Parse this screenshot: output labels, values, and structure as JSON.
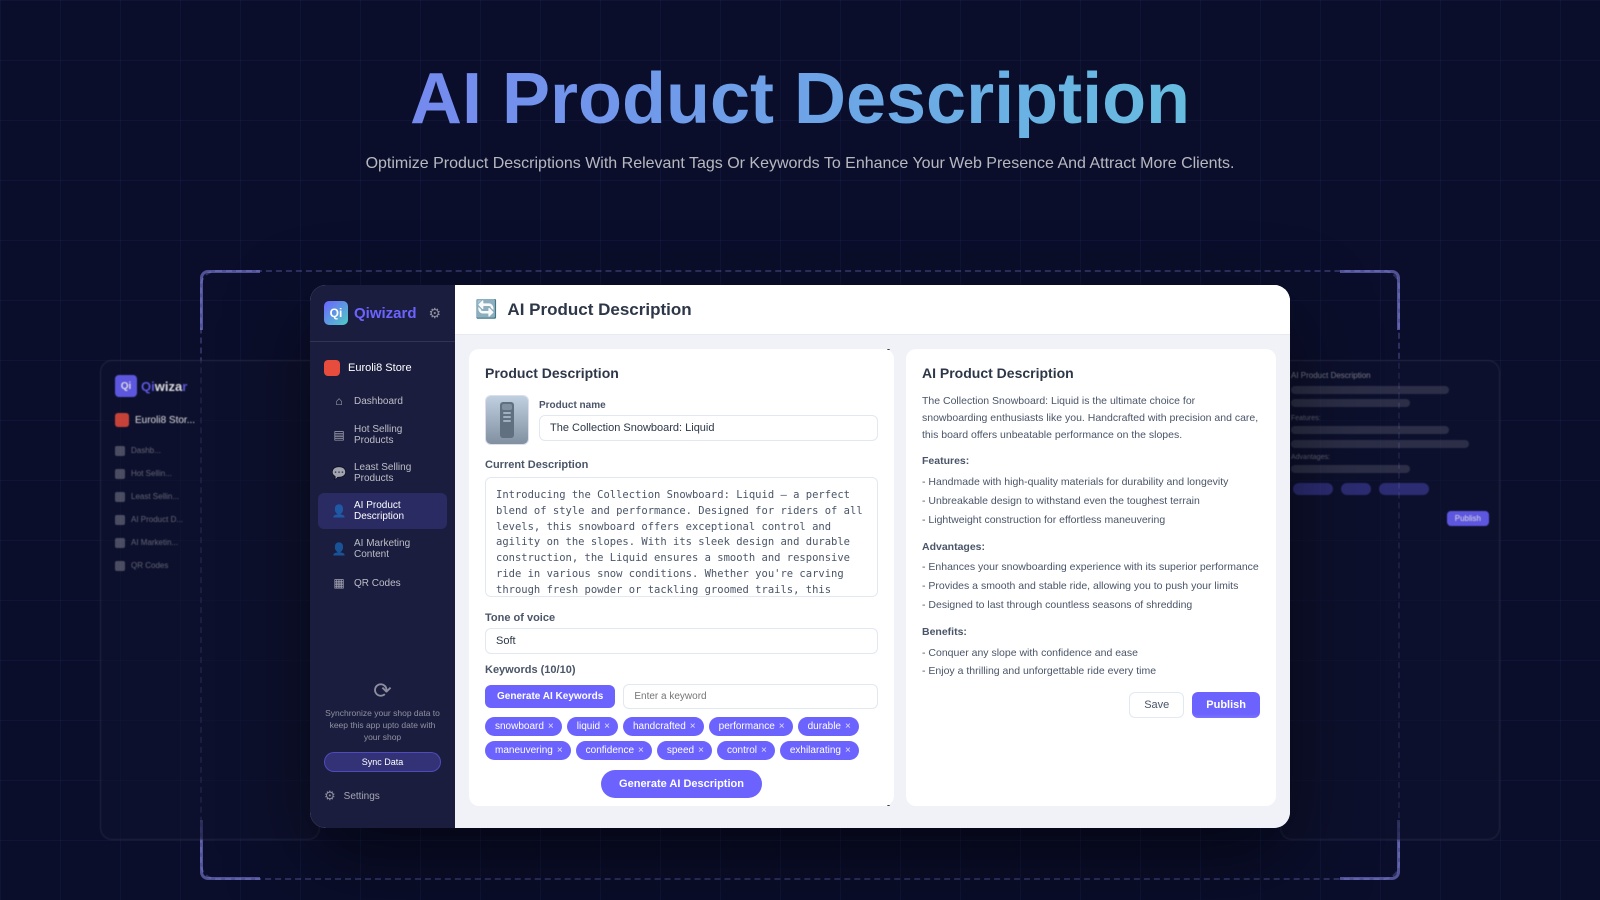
{
  "page": {
    "bg_title": "AI Product Description",
    "bg_subtitle": "Optimize Product Descriptions With Relevant Tags Or Keywords To Enhance Your Web Presence And Attract More Clients."
  },
  "sidebar": {
    "logo_letter": "Qi",
    "logo_name": "wizard",
    "store_name": "Euroli8 Store",
    "nav_items": [
      {
        "id": "dashboard",
        "label": "Dashboard",
        "icon": "⌂"
      },
      {
        "id": "hot-selling",
        "label": "Hot Selling Products",
        "icon": "▤"
      },
      {
        "id": "least-selling",
        "label": "Least Selling Products",
        "icon": "💬"
      },
      {
        "id": "ai-product",
        "label": "AI Product Description",
        "icon": "👤",
        "active": true
      },
      {
        "id": "ai-marketing",
        "label": "AI Marketing Content",
        "icon": "👤"
      },
      {
        "id": "qr-codes",
        "label": "QR Codes",
        "icon": "▦"
      }
    ],
    "sync_text": "Synchronize your shop data to keep this app upto date with your shop",
    "sync_btn": "Sync Data",
    "settings_label": "Settings"
  },
  "main": {
    "page_icon": "🔄",
    "page_title": "AI Product Description",
    "left_panel": {
      "title": "Product Description",
      "product_name_label": "Product name",
      "product_name_value": "The Collection Snowboard: Liquid",
      "current_desc_label": "Current Description",
      "current_desc_value": "Introducing the Collection Snowboard: Liquid – a perfect blend of style and performance. Designed for riders of all levels, this snowboard offers exceptional control and agility on the slopes. With its sleek design and durable construction, the Liquid ensures a smooth and responsive ride in various snow conditions. Whether you're carving through fresh powder or tackling groomed trails, this snowboard adapts effortlessly to enhance your experience. Elevate your snowboarding adventures with the Collection Snowboard: Liquid and enjoy the perfect ride every time.",
      "tone_label": "Tone of voice",
      "tone_value": "Soft",
      "keywords_label": "Keywords (10/10)",
      "generate_ai_keywords_btn": "Generate AI Keywords",
      "keyword_placeholder": "Enter a keyword",
      "tags": [
        "snowboard",
        "liquid",
        "handcrafted",
        "performance",
        "durable",
        "maneuvering",
        "confidence",
        "speed",
        "control",
        "exhilarating"
      ],
      "generate_desc_btn": "Generate AI Description"
    },
    "right_panel": {
      "title": "AI Product Description",
      "intro": "The Collection Snowboard: Liquid is the ultimate choice for snowboarding enthusiasts like you. Handcrafted with precision and care, this board offers unbeatable performance on the slopes.",
      "features_heading": "Features:",
      "features": [
        "- Handmade with high-quality materials for durability and longevity",
        "- Unbreakable design to withstand even the toughest terrain",
        "- Lightweight construction for effortless maneuvering"
      ],
      "advantages_heading": "Advantages:",
      "advantages": [
        "- Enhances your snowboarding experience with its superior performance",
        "- Provides a smooth and stable ride, allowing you to push your limits",
        "- Designed to last through countless seasons of shredding"
      ],
      "benefits_heading": "Benefits:",
      "benefits": [
        "- Conquer any slope with confidence and ease",
        "- Enjoy a thrilling and unforgettable ride every time"
      ],
      "save_btn": "Save",
      "publish_btn": "Publish"
    }
  }
}
